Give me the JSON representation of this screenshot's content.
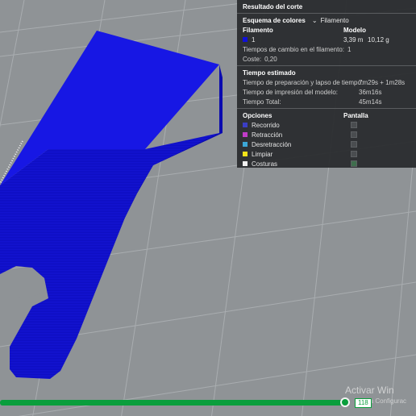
{
  "panel": {
    "title": "Resultado del corte",
    "color_scheme_label": "Esquema de colores",
    "color_scheme_value": "Filamento",
    "filament_header": "Filamento",
    "model_header": "Modelo",
    "filament_index": "1",
    "filament_length": "3,39 m",
    "filament_weight": "10,12 g",
    "change_times_label": "Tiempos de cambio en el filamento:",
    "change_times_value": "1",
    "cost_label": "Coste:",
    "cost_value": "0,20",
    "time_section_title": "Tiempo estimado",
    "prep_time_label": "Tiempo de preparación y lapso de tiempo:",
    "prep_time_value": "7m29s + 1m28s",
    "print_time_label": "Tiempo de impresión del modelo:",
    "print_time_value": "36m16s",
    "total_time_label": "Tiempo Total:",
    "total_time_value": "45m14s",
    "options_header": "Opciones",
    "display_header": "Pantalla",
    "options": [
      {
        "label": "Recorrido",
        "color": "#3a3dc4",
        "checked": false
      },
      {
        "label": "Retracción",
        "color": "#c03cc8",
        "checked": false
      },
      {
        "label": "Desretracción",
        "color": "#3ca7d6",
        "checked": false
      },
      {
        "label": "Limpiar",
        "color": "#f2e21a",
        "checked": false
      },
      {
        "label": "Costuras",
        "color": "#f0f0f0",
        "checked": true
      }
    ]
  },
  "slider": {
    "value": "118"
  },
  "watermark": {
    "line1": "Activar Win",
    "line2": "e a Configurac"
  },
  "colors": {
    "model": "#1010d8",
    "plate": "#8f9396",
    "slider": "#0a9e3c"
  }
}
